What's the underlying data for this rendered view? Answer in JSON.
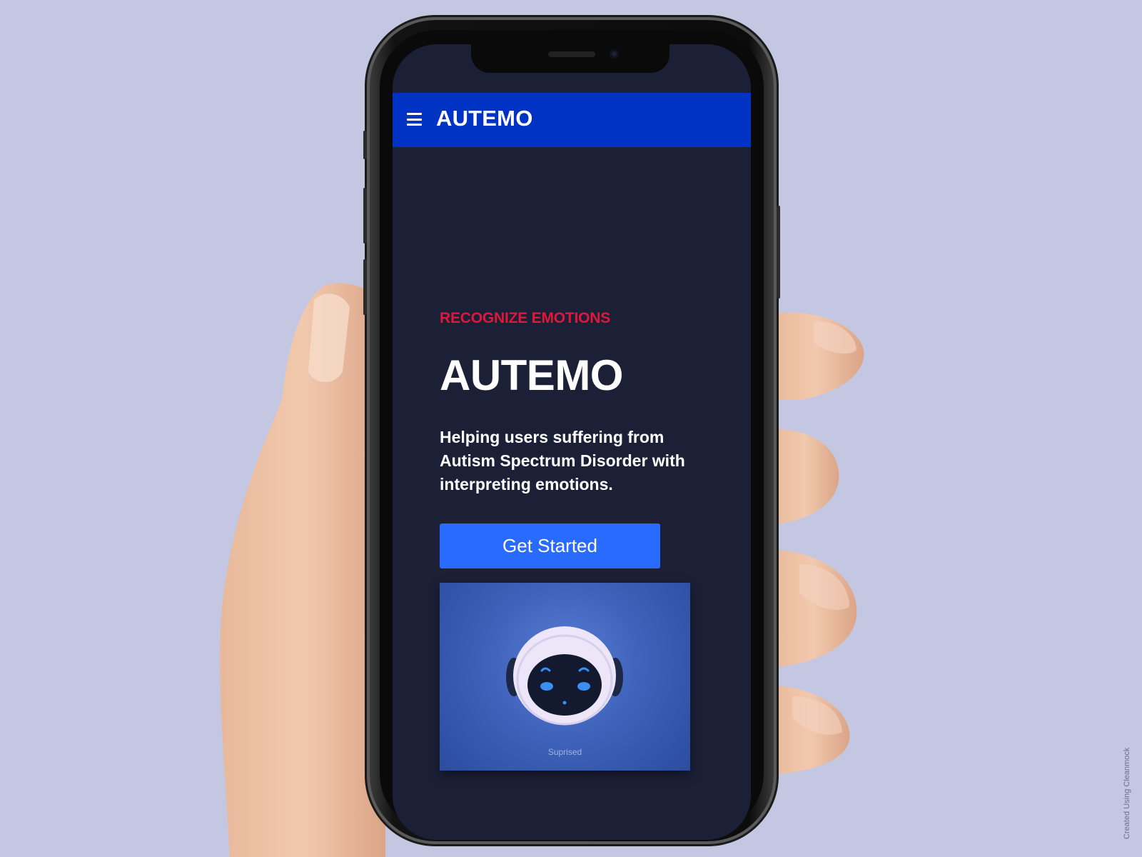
{
  "app_bar": {
    "title": "AUTEMO",
    "menu_icon": "hamburger-menu-icon"
  },
  "hero": {
    "eyebrow": "RECOGNIZE EMOTIONS",
    "title": "AUTEMO",
    "description": "Helping users suffering from Autism Spectrum Disorder with interpreting emotions.",
    "cta_label": "Get Started"
  },
  "preview": {
    "caption": "Suprised",
    "illustration": "robot-face-icon"
  },
  "watermark": "Created Using Cleanmock",
  "colors": {
    "background": "#c3c7e2",
    "screen": "#1c2037",
    "app_bar": "#0033c4",
    "accent_red": "#e0163a",
    "button": "#2a6bff"
  }
}
